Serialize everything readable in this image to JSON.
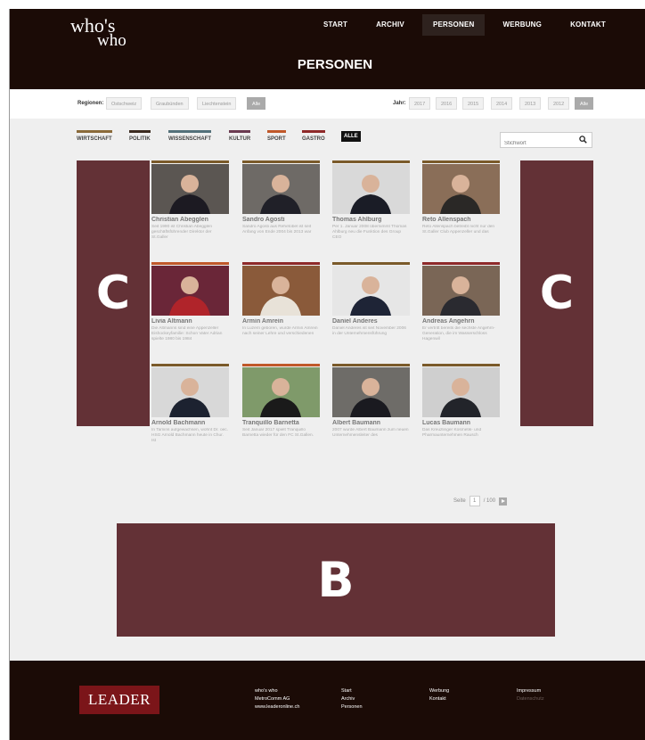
{
  "brand": {
    "logo_line1": "who's",
    "logo_line2": "who"
  },
  "nav": {
    "items": [
      "START",
      "ARCHIV",
      "PERSONEN",
      "WERBUNG",
      "KONTAKT"
    ],
    "active": "PERSONEN"
  },
  "page_title": "PERSONEN",
  "regions": {
    "label": "Regionen:",
    "options": [
      "Ostschweiz",
      "Graubünden",
      "Liechtenstein",
      "Alle"
    ],
    "active": "Alle"
  },
  "years": {
    "label": "Jahr:",
    "options": [
      "2017",
      "2016",
      "2015",
      "2014",
      "2013",
      "2012",
      "Alle"
    ],
    "active": "Alle"
  },
  "categories": [
    {
      "label": "WIRTSCHAFT",
      "color": "#8a6a3a"
    },
    {
      "label": "POLITIK",
      "color": "#3b2a1f"
    },
    {
      "label": "WISSENSCHAFT",
      "color": "#53707a"
    },
    {
      "label": "KULTUR",
      "color": "#6a3a50"
    },
    {
      "label": "SPORT",
      "color": "#c0582a"
    },
    {
      "label": "GASTRO",
      "color": "#8e2a2a"
    },
    {
      "label": "ALLE",
      "color": "#111111"
    }
  ],
  "search": {
    "placeholder": "Stichwort"
  },
  "ads": {
    "left": "C",
    "right": "C",
    "bottom": "B"
  },
  "persons": [
    {
      "name": "Christian Abegglen",
      "desc": "Seit 1990 ist Christian Abegglen geschäftsführender Direktor der St.Galler",
      "bar": "#7a5a2a"
    },
    {
      "name": "Sandro Agosti",
      "desc": "Sandro Agosti aus Rehetobel ist seit Anfang von Ende 2004 bis 2013 war",
      "bar": "#7a5a2a"
    },
    {
      "name": "Thomas Ahlburg",
      "desc": "Per 1. Januar 2008 übernimmt Thomas Ahlburg neu die Funktion des Group CEO",
      "bar": "#7a5a2a"
    },
    {
      "name": "Reto Allenspach",
      "desc": "Reto Allenspach betreibt nicht nur den St.Galler Club Appenzeller und das",
      "bar": "#7a5a2a"
    },
    {
      "name": "Livia Altmann",
      "desc": "Die Altmanns sind eine Appenzeller Eishockeyfamilie: Schon Vater Adrian spielte 1980 bis 1984",
      "bar": "#c0582a"
    },
    {
      "name": "Armin Amrein",
      "desc": "In Luzern geboren, wurde Armin Amrein nach seiner Lehre und verschiedenen",
      "bar": "#8e2a2a"
    },
    {
      "name": "Daniel Anderes",
      "desc": "Daniel Anderes ist seit November 2006 in der Unternehmensführung",
      "bar": "#7a5a2a"
    },
    {
      "name": "Andreas Angehrn",
      "desc": "Er vertritt bereits die sechste Angehrn-Generation, die im Wasserschloss Hagenwil",
      "bar": "#8e2a2a"
    },
    {
      "name": "Arnold Bachmann",
      "desc": "In Tamins aufgewachsen, wohnt Dr. oec. HSG Arnold Bachmann heute in Chur. Ist",
      "bar": "#7a5a2a"
    },
    {
      "name": "Tranquillo Barnetta",
      "desc": "Seit Januar 2017 spielt Tranquillo Barnetta wieder für den FC St.Gallen.",
      "bar": "#c0582a"
    },
    {
      "name": "Albert Baumann",
      "desc": "2007 wurde Albert Baumann zum neuen Unternehmensleiter des",
      "bar": "#7a5a2a"
    },
    {
      "name": "Lucas Baumann",
      "desc": "Das Kreuzlinger Kosmetik- und Pharmaunternehmen Rausch",
      "bar": "#7a5a2a"
    }
  ],
  "pagination": {
    "label": "Seite",
    "current": "1",
    "total": "/ 100"
  },
  "footer": {
    "logo": "LEADER",
    "col1": [
      "who's who",
      "MetroComm AG",
      "www.leaderonline.ch"
    ],
    "col2": [
      "Start",
      "Archiv",
      "Personen"
    ],
    "col3": [
      "Werbung",
      "Kontakt"
    ],
    "col4": [
      "Impressum",
      "Datenschutz"
    ]
  }
}
